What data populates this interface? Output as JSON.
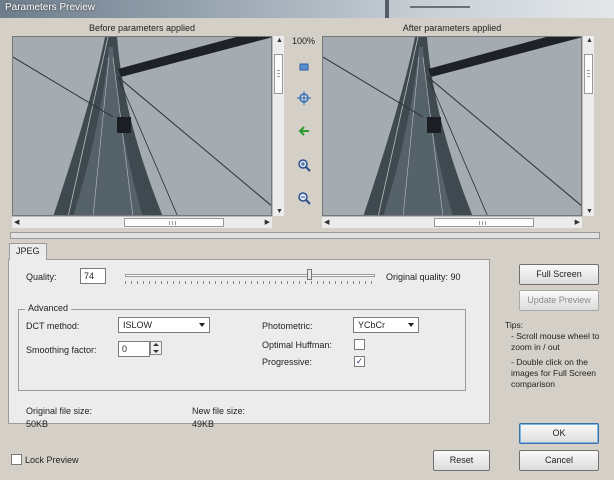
{
  "window": {
    "title": "Parameters Preview"
  },
  "preview": {
    "before_label": "Before parameters applied",
    "after_label": "After parameters applied",
    "zoom": "100%",
    "tools": [
      "fit-icon",
      "center-icon",
      "sync-arrow-icon",
      "zoom-in-icon",
      "zoom-out-icon"
    ]
  },
  "tab": {
    "label": "JPEG"
  },
  "quality": {
    "label": "Quality:",
    "value": "74",
    "original_label": "Original quality: 90",
    "slider_fraction": 0.74
  },
  "advanced": {
    "title": "Advanced",
    "dct_label": "DCT method:",
    "dct_value": "ISLOW",
    "smoothing_label": "Smoothing factor:",
    "smoothing_value": "0",
    "photometric_label": "Photometric:",
    "photometric_value": "YCbCr",
    "optimal_huffman_label": "Optimal Huffman:",
    "optimal_huffman_checked": false,
    "progressive_label": "Progressive:",
    "progressive_checked": true,
    "checkmark": "✓"
  },
  "sizes": {
    "original_label": "Original file size:",
    "original_value": "50KB",
    "new_label": "New file size:",
    "new_value": "49KB"
  },
  "lock_preview_label": "Lock Preview",
  "buttons": {
    "full_screen": "Full Screen",
    "update_preview": "Update Preview",
    "reset": "Reset",
    "ok": "OK",
    "cancel": "Cancel"
  },
  "tips": {
    "title": "Tips:",
    "items": [
      "- Scroll mouse wheel to zoom in / out",
      "- Double click on the images for Full Screen comparison"
    ]
  },
  "colors": {
    "sky": "#9da4aa",
    "sail": "#3f4a50",
    "accent": "#3a6fa8"
  }
}
